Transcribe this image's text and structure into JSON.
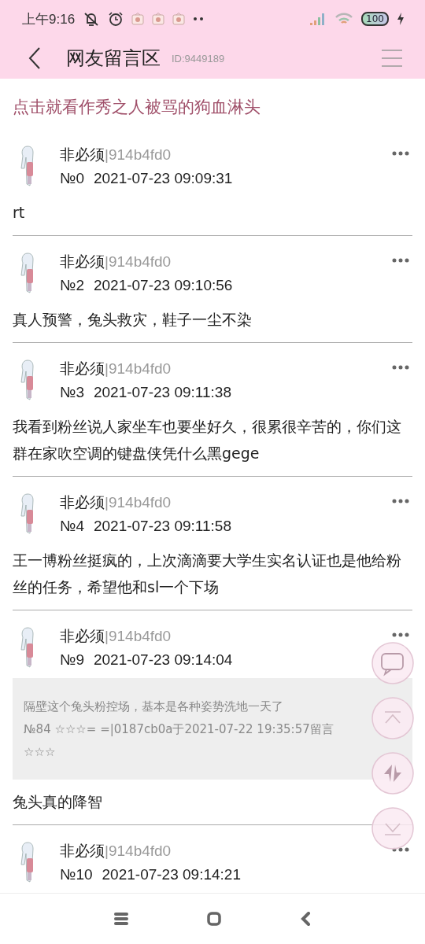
{
  "status_bar": {
    "time": "上午9:16",
    "battery": "100"
  },
  "header": {
    "title": "网友留言区",
    "id": "ID:9449189"
  },
  "topic": "点击就看作秀之人被骂的狗血淋头",
  "comments": [
    {
      "name": "非必须",
      "user_id": "|914b4fd0",
      "number": "№0",
      "time": "2021-07-23 09:09:31",
      "text": "rt"
    },
    {
      "name": "非必须",
      "user_id": "|914b4fd0",
      "number": "№2",
      "time": "2021-07-23 09:10:56",
      "text": "真人预警，兔头救灾，鞋子一尘不染"
    },
    {
      "name": "非必须",
      "user_id": "|914b4fd0",
      "number": "№3",
      "time": "2021-07-23 09:11:38",
      "text": "我看到粉丝说人家坐车也要坐好久，很累很辛苦的，你们这群在家吹空调的键盘侠凭什么黑gege"
    },
    {
      "name": "非必须",
      "user_id": "|914b4fd0",
      "number": "№4",
      "time": "2021-07-23 09:11:58",
      "text": "王一博粉丝挺疯的，上次滴滴要大学生实名认证也是他给粉丝的任务，希望他和sl一个下场"
    },
    {
      "name": "非必须",
      "user_id": "|914b4fd0",
      "number": "№9",
      "time": "2021-07-23 09:14:04",
      "quote": {
        "text": "隔壁这个兔头粉控场，基本是各种姿势洗地一天了",
        "meta": "№84 ☆☆☆= =|0187cb0a于2021-07-22 19:35:57留言☆☆☆"
      },
      "text": "兔头真的降智"
    },
    {
      "name": "非必须",
      "user_id": "|914b4fd0",
      "number": "№10",
      "time": "2021-07-23 09:14:21"
    }
  ],
  "floating_buttons": [
    {
      "kind": "comment"
    },
    {
      "kind": "top"
    },
    {
      "kind": "refresh"
    },
    {
      "kind": "bottom"
    }
  ]
}
